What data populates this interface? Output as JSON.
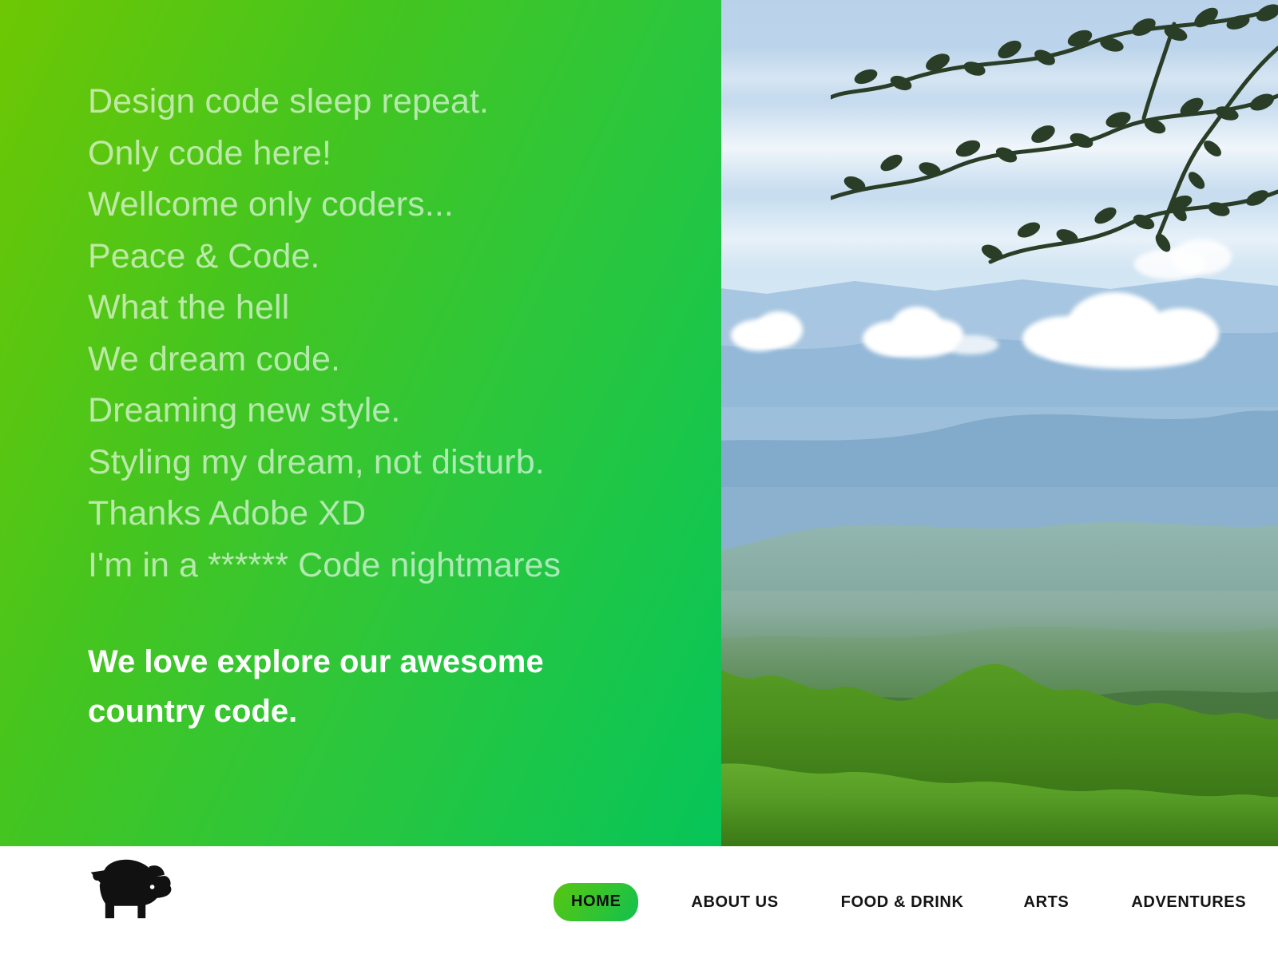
{
  "hero": {
    "poem_lines": [
      "Design code sleep repeat.",
      "Only code here!",
      "Wellcome only coders...",
      "Peace & Code.",
      "What the hell",
      "We dream code.",
      "Dreaming new style.",
      "Styling my dream, not disturb.",
      "Thanks Adobe XD",
      "I'm in a ****** Code nightmares"
    ],
    "headline": "We love explore our awesome country code.",
    "photo_alt": "mountain-landscape-photo"
  },
  "navbar": {
    "logo": "pig-logo",
    "items": [
      {
        "label": "HOME",
        "active": true
      },
      {
        "label": "ABOUT US",
        "active": false
      },
      {
        "label": "FOOD & DRINK",
        "active": false
      },
      {
        "label": "ARTS",
        "active": false
      },
      {
        "label": "ADVENTURES",
        "active": false
      }
    ]
  },
  "colors": {
    "panel_gradient_start": "#6ec703",
    "panel_gradient_end": "#06c559",
    "pill_gradient_start": "#56c513",
    "pill_gradient_end": "#10c150",
    "nav_text": "#141414",
    "poem_text": "rgba(255,255,255,0.62)",
    "headline_text": "#ffffff",
    "navbar_background": "#ffffff"
  }
}
